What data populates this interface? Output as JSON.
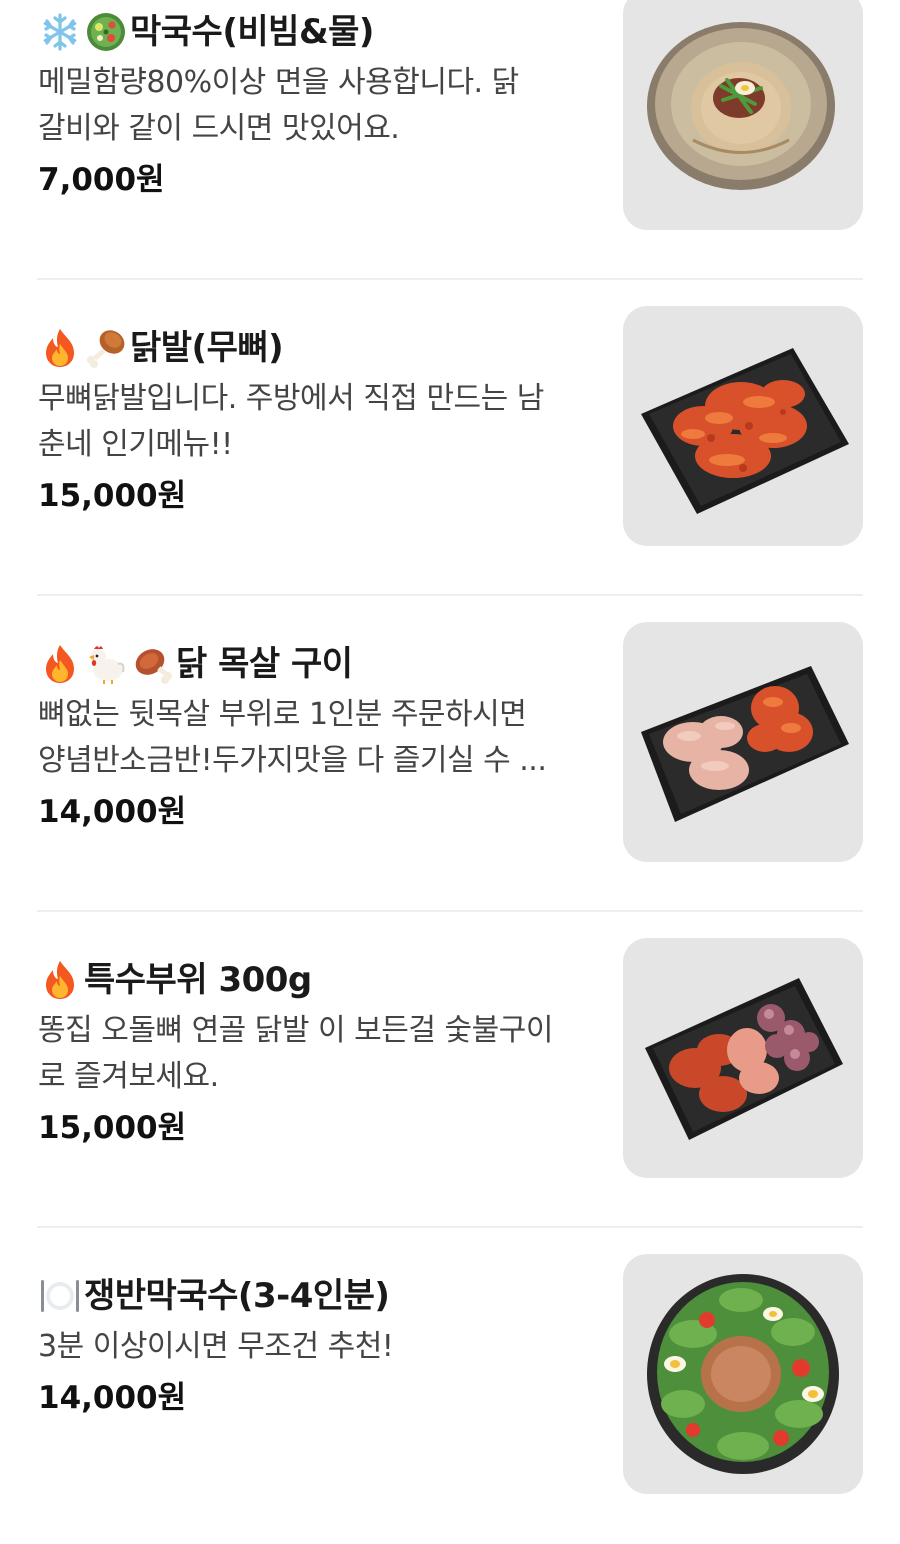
{
  "menu": {
    "items": [
      {
        "icons": [
          "snowflake-icon",
          "salad-icon"
        ],
        "name": "막국수(비빔&물)",
        "description_line1": "메밀함량80%이상 면을 사용합니다. 닭",
        "description_line2": "갈비와 같이 드시면 맛있어요.",
        "price": "7,000원",
        "photo": "buckwheat-noodle-photo"
      },
      {
        "icons": [
          "fire-icon",
          "drumstick-icon"
        ],
        "name": "닭발(무뼈)",
        "description_line1": "무뼈닭발입니다. 주방에서 직접 만드는 남",
        "description_line2": "춘네 인기메뉴!!",
        "price": "15,000원",
        "photo": "boneless-chicken-feet-photo"
      },
      {
        "icons": [
          "fire-icon",
          "chicken-icon",
          "meat-on-bone-icon"
        ],
        "name": "닭 목살 구이",
        "description_line1": "뼈없는 뒷목살 부위로 1인분 주문하시면",
        "description_line2": "양념반소금반!두가지맛을 다 즐기실 수 ...",
        "price": "14,000원",
        "photo": "grilled-chicken-neck-photo"
      },
      {
        "icons": [
          "fire-icon"
        ],
        "name": "특수부위 300g",
        "description_line1": "똥집 오돌뼈 연골 닭발 이 보든걸 숯불구이",
        "description_line2": "로 즐겨보세요.",
        "price": "15,000원",
        "photo": "special-cuts-photo"
      },
      {
        "icons": [
          "plate-icon"
        ],
        "name": "쟁반막국수(3-4인분)",
        "description_line1": "3분 이상이시면 무조건 추천!",
        "description_line2": "",
        "price": "14,000원",
        "photo": "tray-noodle-salad-photo"
      }
    ]
  },
  "colors": {
    "text": "#1a1a1a",
    "description": "#444444",
    "thumb_bg": "#e5e5e5",
    "divider": "#eeeeee"
  }
}
